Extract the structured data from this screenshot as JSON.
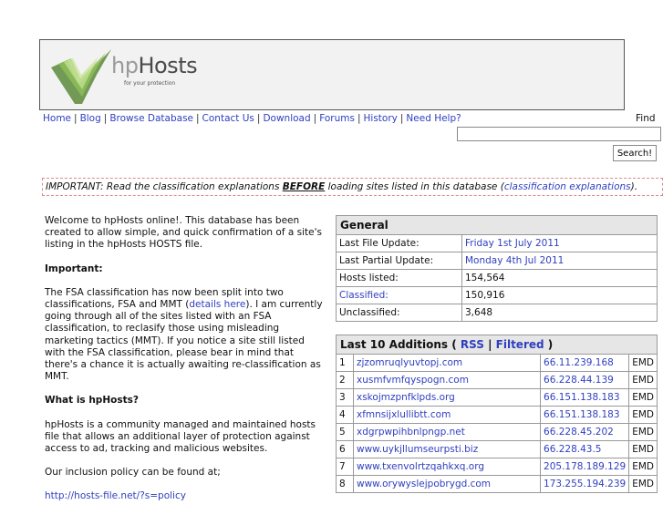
{
  "header": {
    "logo_hp": "hp",
    "logo_hosts": "Hosts",
    "logo_tagline": "for your protection"
  },
  "nav": [
    "Home",
    "Blog",
    "Browse Database",
    "Contact Us",
    "Download",
    "Forums",
    "History",
    "Need Help?"
  ],
  "search": {
    "label": "Find",
    "value": "",
    "button": "Search!"
  },
  "notice": {
    "prefix": "IMPORTANT: Read the classification explanations ",
    "emphasis": "BEFORE",
    "middle": " loading sites listed in this database (",
    "link": "classification explanations",
    "suffix": ")."
  },
  "intro": {
    "welcome": "Welcome to hpHosts online!. This database has been created to allow simple, and quick confirmation of a site's listing in the hpHosts HOSTS file.",
    "important_heading": "Important:",
    "fsa_before": "The FSA classification has now been split into two classifications, FSA and MMT (",
    "fsa_link": "details here",
    "fsa_after": "). I am currently going through all of the sites listed with an FSA classification, to reclasify those using misleading marketing tactics (MMT). If you notice a site still listed with the FSA classification, please bear in mind that there's a chance it is actually awaiting re-classification as MMT.",
    "what_heading": "What is hpHosts?",
    "what_text": "hpHosts is a community managed and maintained hosts file that allows an additional layer of protection against access to ad, tracking and malicious websites.",
    "policy_text": "Our inclusion policy can be found at;",
    "policy_link": "http://hosts-file.net/?s=policy"
  },
  "general": {
    "title": "General",
    "rows": [
      {
        "label": "Last File Update:",
        "value": "Friday 1st July 2011",
        "label_link": false,
        "value_link": true
      },
      {
        "label": "Last Partial Update:",
        "value": "Monday 4th Jul 2011",
        "label_link": false,
        "value_link": true
      },
      {
        "label": "Hosts listed:",
        "value": "154,564",
        "label_link": false,
        "value_link": false
      },
      {
        "label": "Classified:",
        "value": "150,916",
        "label_link": true,
        "value_link": false
      },
      {
        "label": "Unclassified:",
        "value": "3,648",
        "label_link": false,
        "value_link": false
      }
    ]
  },
  "additions": {
    "title_prefix": "Last 10 Additions ( ",
    "rss": "RSS",
    "sep": " | ",
    "filtered": "Filtered",
    "title_suffix": " )",
    "rows": [
      {
        "n": "1",
        "host": "zjzomruqlyuvtopj.com",
        "ip": "66.11.239.168",
        "cls": "EMD"
      },
      {
        "n": "2",
        "host": "xusmfvmfqyspogn.com",
        "ip": "66.228.44.139",
        "cls": "EMD"
      },
      {
        "n": "3",
        "host": "xskojmzpnfklpds.org",
        "ip": "66.151.138.183",
        "cls": "EMD"
      },
      {
        "n": "4",
        "host": "xfmnsijxlullibtt.com",
        "ip": "66.151.138.183",
        "cls": "EMD"
      },
      {
        "n": "5",
        "host": "xdgrpwpihbnlpngp.net",
        "ip": "66.228.45.202",
        "cls": "EMD"
      },
      {
        "n": "6",
        "host": "www.uykjllumseurpsti.biz",
        "ip": "66.228.43.5",
        "cls": "EMD"
      },
      {
        "n": "7",
        "host": "www.txenvolrtzqahkxq.org",
        "ip": "205.178.189.129",
        "cls": "EMD"
      },
      {
        "n": "8",
        "host": "www.orywyslejpobrygd.com",
        "ip": "173.255.194.239",
        "cls": "EMD"
      }
    ]
  }
}
